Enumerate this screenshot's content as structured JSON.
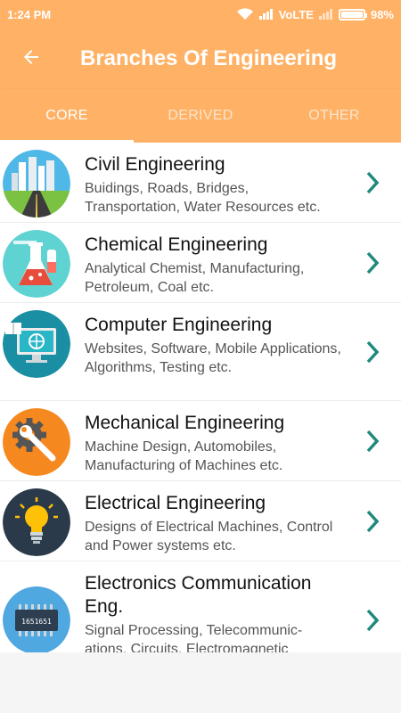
{
  "status": {
    "time": "1:24 PM",
    "network": "VoLTE",
    "battery": "98%",
    "battery_level": 0.98
  },
  "appbar": {
    "title": "Branches Of Engineering",
    "back_icon": "arrow-left-icon"
  },
  "tabs": [
    {
      "label": "CORE",
      "active": true
    },
    {
      "label": "DERIVED",
      "active": false
    },
    {
      "label": "OTHER",
      "active": false
    }
  ],
  "branches": [
    {
      "title": "Civil Engineering",
      "desc": "Buidings, Roads, Bridges, Transportation, Water Resources etc.",
      "icon": "city-road-icon"
    },
    {
      "title": "Chemical Engineering",
      "desc": "Analytical Chemist, Manufacturing, Petroleum, Coal etc.",
      "icon": "flask-icon"
    },
    {
      "title": "Computer Engineering",
      "desc": "Websites, Software, Mobile Applications, Algorithms, Testing etc.",
      "icon": "computer-icon"
    },
    {
      "title": "Mechanical Engineering",
      "desc": "Machine Design, Automobiles, Manufacturing of Machines etc.",
      "icon": "gear-wrench-icon"
    },
    {
      "title": "Electrical Engineering",
      "desc": "Designs of Electrical Machines, Control and Power systems etc.",
      "icon": "lightbulb-icon"
    },
    {
      "title": "Electronics Communication Eng.",
      "desc": "Signal Processing, Telecommunic-ations, Circuits, Electromagnetic",
      "icon": "chip-icon",
      "chip_label": "1651651"
    }
  ],
  "colors": {
    "accent": "#ffb266",
    "chevron": "#1f8a7c"
  }
}
